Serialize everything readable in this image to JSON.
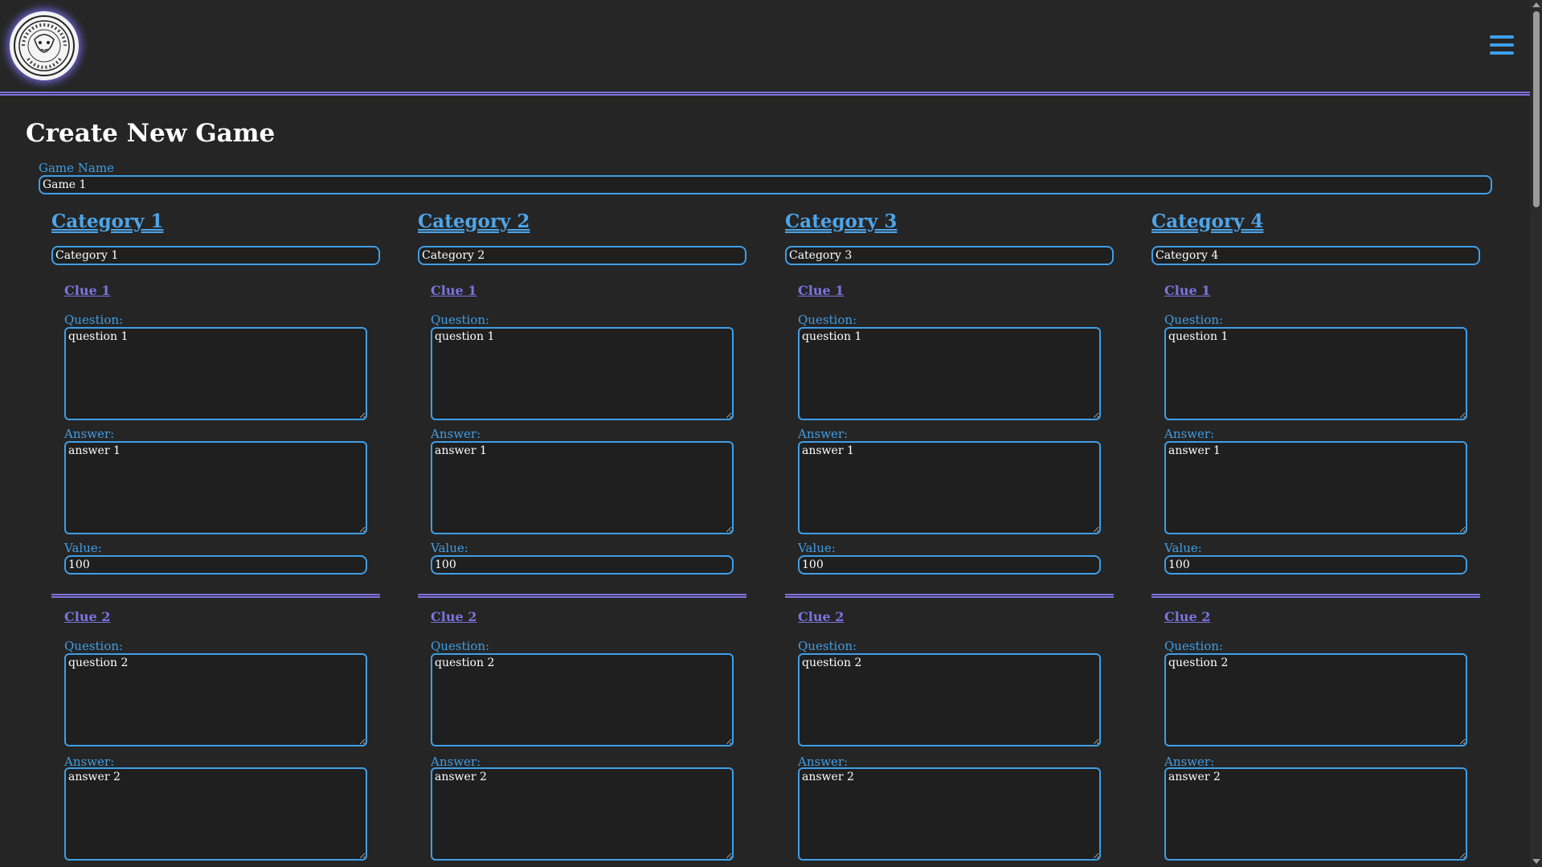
{
  "header": {
    "logo_icon": "brewing-logo-icon",
    "menu_icon": "hamburger-menu-icon"
  },
  "page": {
    "title": "Create New Game"
  },
  "game": {
    "name_label": "Game Name",
    "name_value": "Game 1"
  },
  "labels": {
    "question": "Question:",
    "answer": "Answer:",
    "value": "Value:"
  },
  "categories": [
    {
      "title": "Category 1",
      "name_value": "Category 1",
      "clues": [
        {
          "title": "Clue 1",
          "question": "question 1",
          "answer": "answer 1",
          "value": "100"
        },
        {
          "title": "Clue 2",
          "question": "question 2",
          "answer": "answer 2"
        }
      ]
    },
    {
      "title": "Category 2",
      "name_value": "Category 2",
      "clues": [
        {
          "title": "Clue 1",
          "question": "question 1",
          "answer": "answer 1",
          "value": "100"
        },
        {
          "title": "Clue 2",
          "question": "question 2",
          "answer": "answer 2"
        }
      ]
    },
    {
      "title": "Category 3",
      "name_value": "Category 3",
      "clues": [
        {
          "title": "Clue 1",
          "question": "question 1",
          "answer": "answer 1",
          "value": "100"
        },
        {
          "title": "Clue 2",
          "question": "question 2",
          "answer": "answer 2"
        }
      ]
    },
    {
      "title": "Category 4",
      "name_value": "Category 4",
      "clues": [
        {
          "title": "Clue 1",
          "question": "question 1",
          "answer": "answer 1",
          "value": "100"
        },
        {
          "title": "Clue 2",
          "question": "question 2",
          "answer": "answer 2"
        }
      ]
    }
  ],
  "colors": {
    "accent": "#3f9ee6",
    "divider": "#7f73e0",
    "background": "#252525"
  }
}
